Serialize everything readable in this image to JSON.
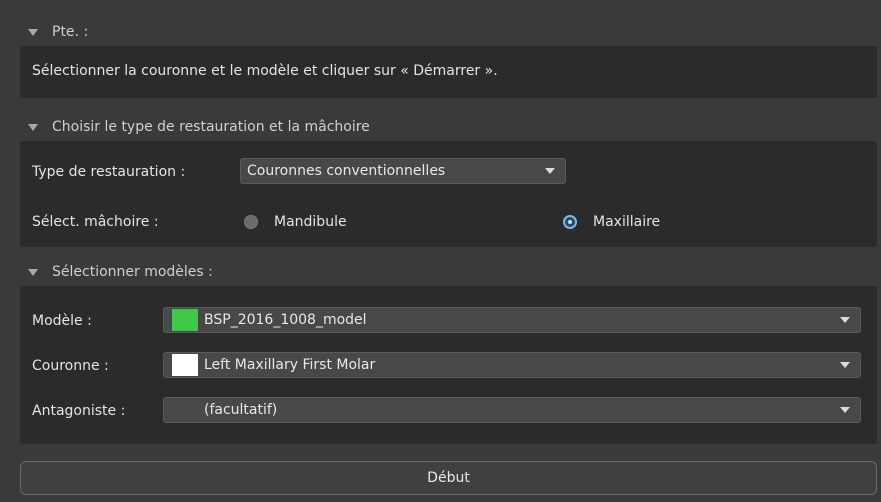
{
  "sections": {
    "pte": {
      "title": "Pte. :",
      "instruction": "Sélectionner la couronne et le modèle et cliquer sur « Démarrer »."
    },
    "restoration": {
      "title": "Choisir le type de restauration et la mâchoire",
      "type_label": "Type de restauration :",
      "type_value": "Couronnes conventionnelles",
      "jaw_label": "Sélect. mâchoire :",
      "options": [
        {
          "label": "Mandibule",
          "selected": false
        },
        {
          "label": "Maxillaire",
          "selected": true
        }
      ]
    },
    "models": {
      "title": "Sélectionner modèles :",
      "rows": [
        {
          "label": "Modèle :",
          "value": "BSP_2016_1008_model",
          "swatch": "#3ec94a"
        },
        {
          "label": "Couronne :",
          "value": "Left Maxillary First Molar",
          "swatch": "#ffffff"
        },
        {
          "label": "Antagoniste :",
          "value": "(facultatif)",
          "swatch": ""
        }
      ]
    }
  },
  "start_button": "Début",
  "colors": {
    "accent": "#7fb7e6",
    "panel": "#2b2b2b",
    "background": "#3a3a3a"
  }
}
